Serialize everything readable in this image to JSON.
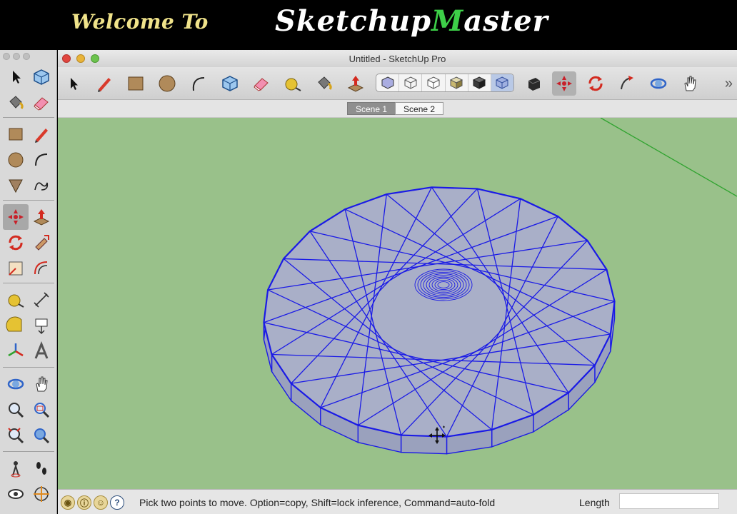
{
  "banner": {
    "welcome_text": "Welcome To",
    "brand_prefix": "Sketchup",
    "brand_accent": "M",
    "brand_suffix": "aster"
  },
  "window": {
    "title": "Untitled - SketchUp Pro"
  },
  "scenes": {
    "tabs": [
      {
        "label": "Scene 1",
        "active": true
      },
      {
        "label": "Scene 2",
        "active": false
      }
    ]
  },
  "status": {
    "message": "Pick two points to move.  Option=copy, Shift=lock inference, Command=auto-fold",
    "help_glyph": "?",
    "vcb_label": "Length",
    "vcb_value": ""
  },
  "colors": {
    "ground": "#99c18a",
    "selection_edges": "#1a1ae6",
    "model_face": "#a9afc8",
    "red_axis": "#c23b3b",
    "green_axis": "#2fa32f"
  },
  "toolbar_icons": [
    "select-icon",
    "pencil-icon",
    "rectangle-icon",
    "circle-icon",
    "arc-icon",
    "make-component-icon",
    "eraser-icon",
    "tape-measure-icon",
    "paint-bucket-icon",
    "push-pull-icon",
    "move-icon",
    "rotate-icon",
    "follow-me-icon",
    "orbit-icon",
    "pan-icon"
  ],
  "style_icons": [
    "xray-style-icon",
    "wireframe-style-icon",
    "hidden-line-style-icon",
    "shaded-style-icon",
    "shaded-textures-style-icon",
    "monochrome-style-icon"
  ],
  "palette_icons": [
    "select-icon",
    "make-component-icon",
    "paint-bucket-icon",
    "eraser-icon",
    "rectangle-icon",
    "pencil-icon",
    "circle-icon",
    "arc-icon",
    "polygon-icon",
    "freehand-icon",
    "move-icon",
    "push-pull-icon",
    "rotate-icon",
    "follow-me-icon",
    "scale-icon",
    "offset-icon",
    "tape-measure-icon",
    "dimension-icon",
    "protractor-icon",
    "text-icon",
    "axes-icon",
    "3d-text-icon",
    "orbit-icon",
    "pan-icon",
    "zoom-icon",
    "zoom-window-icon",
    "zoom-extents-icon",
    "previous-view-icon",
    "position-camera-icon",
    "walk-icon",
    "look-around-icon",
    "section-plane-icon"
  ]
}
